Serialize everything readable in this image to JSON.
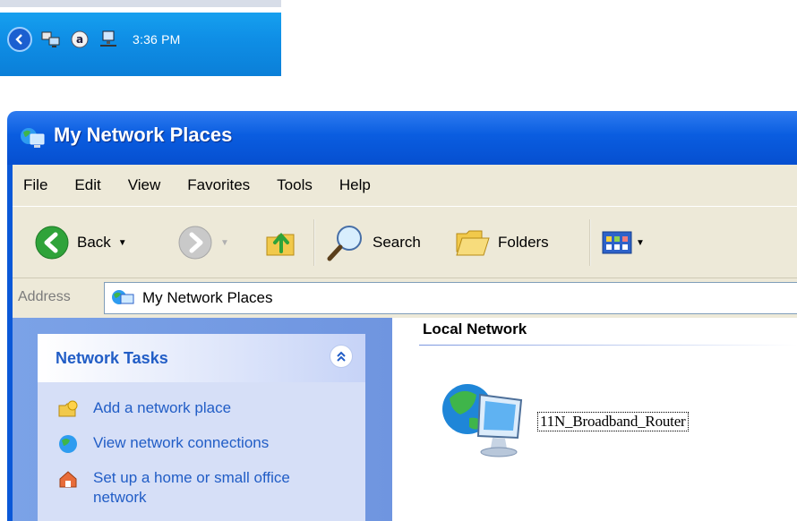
{
  "tray": {
    "clock": "3:36 PM",
    "icons": [
      "show-hidden-icons-chevron",
      "network-connections-icon",
      "assistant-icon",
      "network-status-icon"
    ]
  },
  "window": {
    "title": "My Network Places",
    "menu": [
      {
        "label": "File"
      },
      {
        "label": "Edit"
      },
      {
        "label": "View"
      },
      {
        "label": "Favorites"
      },
      {
        "label": "Tools"
      },
      {
        "label": "Help"
      }
    ],
    "toolbar": {
      "back_label": "Back",
      "search_label": "Search",
      "folders_label": "Folders"
    },
    "address": {
      "label": "Address",
      "value": "My Network Places"
    },
    "tasks": {
      "title": "Network Tasks",
      "items": [
        {
          "label": "Add a network place",
          "icon": "add-network-place-icon"
        },
        {
          "label": "View network connections",
          "icon": "network-connections-icon"
        },
        {
          "label": "Set up a home or small office network",
          "icon": "home-network-icon"
        }
      ]
    },
    "group": {
      "title": "Local Network",
      "items": [
        {
          "label": "11N_Broadband_Router",
          "icon": "network-device-icon"
        }
      ]
    }
  },
  "colors": {
    "title_bar": "#0a5de0",
    "menu_bg": "#ede9d8",
    "task_pane": "#7ba2e7",
    "task_link": "#215dc6",
    "taskbar": "#0f8fe6"
  }
}
